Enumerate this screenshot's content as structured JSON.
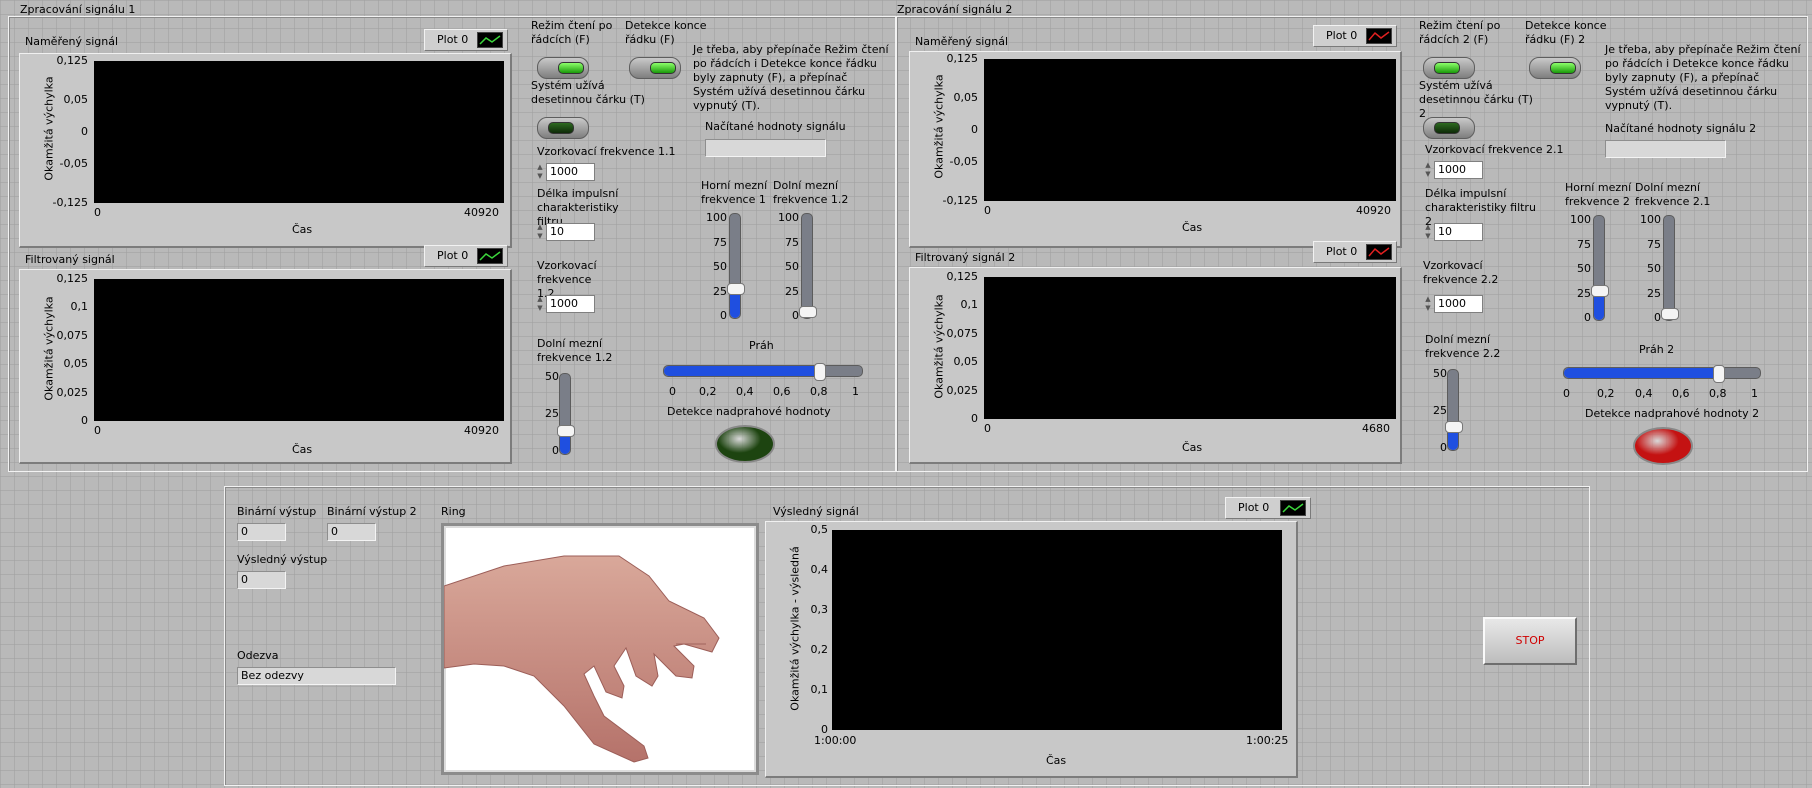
{
  "sig1": {
    "title": "Zpracování signálu 1",
    "graph_measured": {
      "label": "Naměřený signál",
      "ylabel": "Okamžitá výchylka",
      "xlabel": "Čas",
      "legend": "Plot 0",
      "yticks": [
        "0,125",
        "0,05",
        "0",
        "-0,05",
        "-0,125"
      ],
      "xmin": "0",
      "xmax": "40920"
    },
    "graph_filtered": {
      "label": "Filtrovaný signál",
      "ylabel": "Okamžitá výchylka",
      "xlabel": "Čas",
      "legend": "Plot 0",
      "yticks": [
        "0,125",
        "0,1",
        "0,075",
        "0,05",
        "0,025",
        "0"
      ],
      "xmin": "0",
      "xmax": "40920"
    },
    "mode_label": "Režim čtení po řádcích (F)",
    "eol_label": "Detekce konce řádku (F)",
    "decimal_label": "Systém užívá desetinnou čárku (T)",
    "note": "Je třeba, aby přepínače Režim čtení po řádcích i Detekce konce řádku byly zapnuty (F), a přepínač Systém užívá desetinnou čárku vypnutý (T).",
    "read_values_label": "Načítané hodnoty signálu",
    "read_values": "",
    "fs_label": "Vzorkovací frekvence 1.1",
    "fs_value": "1000",
    "len_label": "Délka impulsní charakteristiky filtru",
    "len_value": "10",
    "fs2_label": "Vzorkovací frekvence 1.2",
    "fs2_value": "1000",
    "low_label": "Dolní mezní frekvence 1.2",
    "low_ticks": [
      "50",
      "25",
      "0"
    ],
    "low_value": 12,
    "upper_label": "Horní mezní frekvence 1",
    "lower_label": "Dolní mezní frekvence 1.2",
    "vs_ticks": [
      "100",
      "75",
      "50",
      "25",
      "0"
    ],
    "upper_value": 25,
    "lower_value": 0,
    "threshold_label": "Práh",
    "threshold_value": 0.8,
    "threshold_ticks": [
      "0",
      "0,2",
      "0,4",
      "0,6",
      "0,8",
      "1"
    ],
    "detect_label": "Detekce nadprahové hodnoty",
    "led_color": "#1d4410"
  },
  "sig2": {
    "title": "Zpracování signálu 2",
    "graph_measured": {
      "label": "Naměřený signál",
      "ylabel": "Okamžitá výchylka",
      "xlabel": "Čas",
      "legend": "Plot 0",
      "yticks": [
        "0,125",
        "0,05",
        "0",
        "-0,05",
        "-0,125"
      ],
      "xmin": "0",
      "xmax": "40920"
    },
    "graph_filtered": {
      "label": "Filtrovaný signál 2",
      "ylabel": "Okamžitá výchylka",
      "xlabel": "Čas",
      "legend": "Plot 0",
      "yticks": [
        "0,125",
        "0,1",
        "0,075",
        "0,05",
        "0,025",
        "0"
      ],
      "xmin": "0",
      "xmax": "4680"
    },
    "mode_label": "Režim čtení po řádcích 2 (F)",
    "eol_label": "Detekce konce řádku (F) 2",
    "decimal_label": "Systém užívá desetinnou čárku (T) 2",
    "note": "Je třeba, aby přepínače Režim čtení po řádcích i Detekce konce řádku byly zapnuty (F), a přepínač Systém užívá desetinnou čárku vypnutý (T).",
    "read_values_label": "Načítané hodnoty signálu 2",
    "read_values": "",
    "fs_label": "Vzorkovací frekvence 2.1",
    "fs_value": "1000",
    "len_label": "Délka impulsní charakteristiky filtru 2",
    "len_value": "10",
    "fs2_label": "Vzorkovací frekvence 2.2",
    "fs2_value": "1000",
    "low_label": "Dolní mezní frekvence 2.2",
    "low_ticks": [
      "50",
      "25",
      "0"
    ],
    "low_value": 12,
    "upper_label": "Horní mezní frekvence 2",
    "lower_label": "Dolní mezní frekvence 2.1",
    "vs_ticks": [
      "100",
      "75",
      "50",
      "25",
      "0"
    ],
    "upper_value": 25,
    "lower_value": 0,
    "threshold_label": "Práh  2",
    "threshold_value": 0.8,
    "threshold_ticks": [
      "0",
      "0,2",
      "0,4",
      "0,6",
      "0,8",
      "1"
    ],
    "detect_label": "Detekce nadprahové hodnoty 2",
    "led_color": "#c41212"
  },
  "bottom": {
    "bin_out_label": "Binární výstup",
    "bin_out_value": "0",
    "bin_out2_label": "Binární výstup 2",
    "bin_out2_value": "0",
    "result_out_label": "Výsledný výstup",
    "result_out_value": "0",
    "response_label": "Odezva",
    "response_value": "Bez odezvy",
    "ring_label": "Ring",
    "result_graph": {
      "label": "Výsledný signál",
      "ylabel": "Okamžitá výchylka  - výsledná",
      "xlabel": "Čas",
      "legend": "Plot 0",
      "yticks": [
        "0,5",
        "0,4",
        "0,3",
        "0,2",
        "0,1",
        "0"
      ],
      "xmin": "1:00:00",
      "xmax": "1:00:25"
    },
    "stop_label": "STOP"
  }
}
